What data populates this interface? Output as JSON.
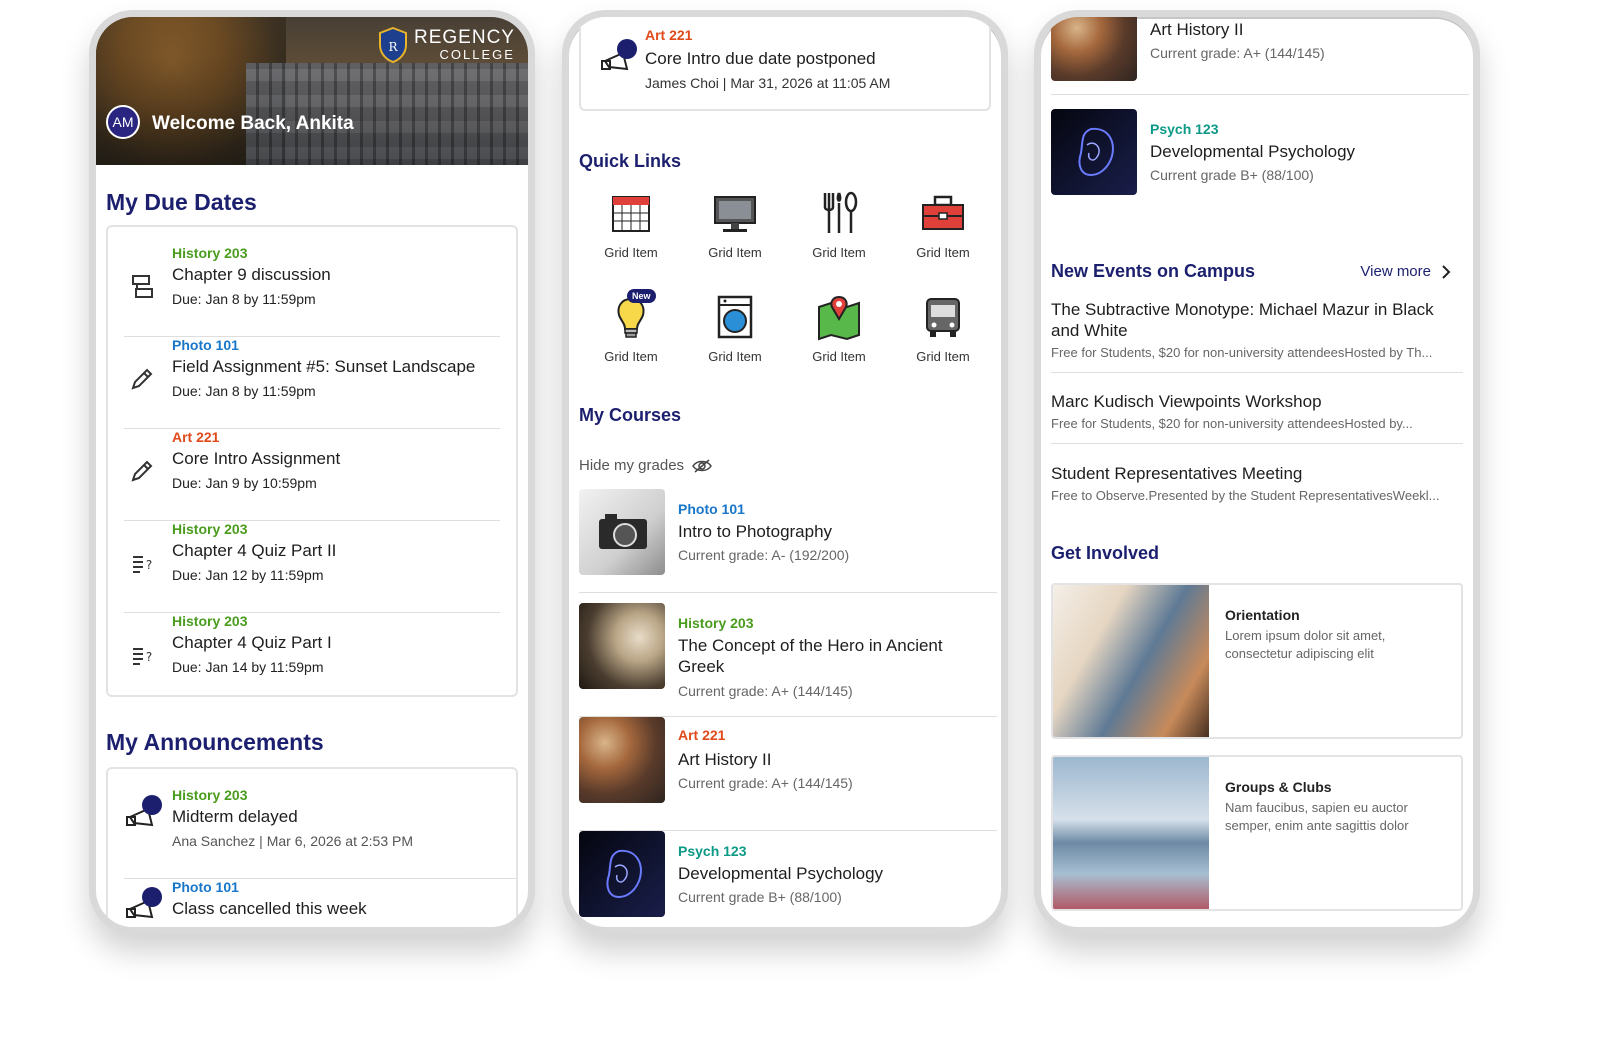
{
  "phone1": {
    "logo_line1": "REGENCY",
    "logo_line2": "COLLEGE",
    "avatar_initials": "AM",
    "welcome": "Welcome Back, Ankita",
    "due_title": "My Due Dates",
    "due_items": [
      {
        "course": "History 203",
        "title": "Chapter 9 discussion",
        "due": "Due: Jan 8 by 11:59pm",
        "icon": "discussion-icon"
      },
      {
        "course": "Photo 101",
        "title": "Field Assignment #5: Sunset Landscape",
        "due": "Due: Jan 8 by 11:59pm",
        "icon": "pencil-icon"
      },
      {
        "course": "Art 221",
        "title": "Core Intro Assignment",
        "due": "Due: Jan 9 by 10:59pm",
        "icon": "pencil-icon"
      },
      {
        "course": "History 203",
        "title": "Chapter 4 Quiz Part II",
        "due": "Due: Jan 12 by 11:59pm",
        "icon": "quiz-icon"
      },
      {
        "course": "History 203",
        "title": "Chapter 4 Quiz Part I",
        "due": "Due: Jan 14 by 11:59pm",
        "icon": "quiz-icon"
      }
    ],
    "ann_title": "My Announcements",
    "announcements": [
      {
        "course": "History 203",
        "title": "Midterm delayed",
        "meta": "Ana Sanchez | Mar 6, 2026 at 2:53 PM"
      },
      {
        "course": "Photo 101",
        "title": "Class cancelled this week",
        "meta": ""
      }
    ]
  },
  "phone2": {
    "top_ann": {
      "course": "Art 221",
      "title": "Core Intro due date postponed",
      "meta": "James Choi | Mar 31, 2026 at 11:05 AM"
    },
    "quick_title": "Quick Links",
    "quick_links": [
      {
        "label": "Grid Item",
        "icon": "calendar-icon"
      },
      {
        "label": "Grid Item",
        "icon": "monitor-icon"
      },
      {
        "label": "Grid Item",
        "icon": "dining-icon"
      },
      {
        "label": "Grid Item",
        "icon": "toolbox-icon"
      },
      {
        "label": "Grid Item",
        "icon": "lightbulb-icon",
        "badge": "New"
      },
      {
        "label": "Grid Item",
        "icon": "laundry-icon"
      },
      {
        "label": "Grid Item",
        "icon": "map-icon"
      },
      {
        "label": "Grid Item",
        "icon": "bus-icon"
      }
    ],
    "courses_title": "My Courses",
    "hide_grades": "Hide my grades",
    "courses": [
      {
        "course": "Photo 101",
        "title": "Intro to Photography",
        "grade": "Current grade: A- (192/200)"
      },
      {
        "course": "History 203",
        "title": "The Concept of the Hero in Ancient Greek",
        "grade": "Current grade: A+ (144/145)"
      },
      {
        "course": "Art 221",
        "title": "Art History II",
        "grade": "Current grade: A+ (144/145)"
      },
      {
        "course": "Psych 123",
        "title": "Developmental Psychology",
        "grade": "Current grade B+ (88/100)"
      }
    ]
  },
  "phone3": {
    "courses": [
      {
        "course": "",
        "title": "Art History II",
        "grade": "Current grade: A+ (144/145)"
      },
      {
        "course": "Psych 123",
        "title": "Developmental Psychology",
        "grade": "Current grade B+ (88/100)"
      }
    ],
    "events_title": "New Events on Campus",
    "view_more": "View more",
    "events": [
      {
        "title": "The Subtractive Monotype: Michael Mazur in Black and White",
        "desc": "Free for Students, $20 for non-university attendeesHosted by Th..."
      },
      {
        "title": "Marc Kudisch Viewpoints Workshop",
        "desc": "Free for Students, $20 for non-university attendeesHosted by..."
      },
      {
        "title": "Student Representatives Meeting",
        "desc": "Free to Observe.Presented by the Student RepresentativesWeekl..."
      }
    ],
    "involved_title": "Get Involved",
    "involved": [
      {
        "title": "Orientation",
        "desc": "Lorem ipsum dolor sit amet, consectetur adipiscing elit"
      },
      {
        "title": "Groups & Clubs",
        "desc": "Nam faucibus, sapien eu auctor semper, enim ante sagittis dolor"
      }
    ]
  },
  "colors": {
    "navy": "#1b1f6e",
    "history": "#4a9c1e",
    "photo": "#1877c9",
    "art": "#e04a1a",
    "psych": "#0c9a86"
  }
}
